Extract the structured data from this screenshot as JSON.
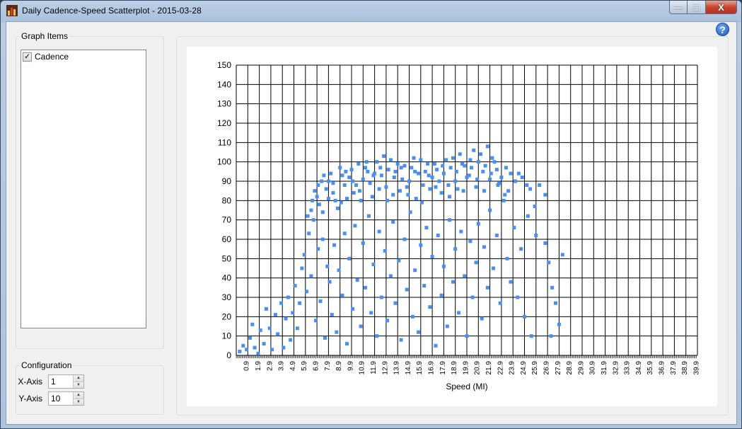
{
  "window": {
    "title": "Daily Cadence-Speed Scatterplot - 2015-03-28"
  },
  "caption_buttons": {
    "minimize": "—",
    "maximize": "□",
    "close": "X"
  },
  "help": {
    "label": "?"
  },
  "graph_items": {
    "legend": "Graph Items",
    "items": [
      {
        "label": "Cadence",
        "checked": true
      }
    ]
  },
  "configuration": {
    "legend": "Configuration",
    "x_axis": {
      "label": "X-Axis",
      "value": "1"
    },
    "y_axis": {
      "label": "Y-Axis",
      "value": "10"
    }
  },
  "colors": {
    "point": "#4a8ff0",
    "grid": "#000000"
  },
  "chart_data": {
    "type": "scatter",
    "xlabel": "Speed (MI)",
    "ylabel": "",
    "xlim": [
      0,
      40
    ],
    "ylim": [
      0,
      150
    ],
    "x_ticks": [
      "0.9",
      "1.9",
      "2.9",
      "3.9",
      "4.9",
      "5.9",
      "6.9",
      "7.9",
      "8.9",
      "9.9",
      "10.9",
      "11.9",
      "12.9",
      "13.9",
      "14.9",
      "15.9",
      "16.9",
      "17.9",
      "18.9",
      "19.9",
      "20.9",
      "21.9",
      "22.9",
      "23.9",
      "24.9",
      "25.9",
      "26.9",
      "27.9",
      "28.9",
      "29.9",
      "30.9",
      "31.9",
      "32.9",
      "33.9",
      "34.9",
      "35.9",
      "36.9",
      "37.9",
      "38.9",
      "39.9"
    ],
    "y_ticks": [
      "0",
      "10",
      "20",
      "30",
      "40",
      "50",
      "60",
      "70",
      "80",
      "90",
      "100",
      "110",
      "120",
      "130",
      "140",
      "150"
    ],
    "series": [
      {
        "color": "#4a8ff0",
        "points": [
          [
            0.3,
            2
          ],
          [
            0.6,
            5
          ],
          [
            0.9,
            3
          ],
          [
            1.2,
            9
          ],
          [
            1.4,
            16
          ],
          [
            1.6,
            4
          ],
          [
            1.9,
            1
          ],
          [
            2.1,
            13
          ],
          [
            2.4,
            6
          ],
          [
            2.6,
            24
          ],
          [
            2.9,
            14
          ],
          [
            3.1,
            3
          ],
          [
            3.4,
            21
          ],
          [
            3.6,
            11
          ],
          [
            3.9,
            27
          ],
          [
            4.1,
            4
          ],
          [
            4.3,
            19
          ],
          [
            4.5,
            30
          ],
          [
            4.7,
            8
          ],
          [
            4.9,
            22
          ],
          [
            5.1,
            36
          ],
          [
            5.3,
            14
          ],
          [
            5.5,
            27
          ],
          [
            5.7,
            45
          ],
          [
            5.9,
            52
          ],
          [
            6.1,
            33
          ],
          [
            6.3,
            63
          ],
          [
            6.5,
            41
          ],
          [
            6.7,
            70
          ],
          [
            6.9,
            18
          ],
          [
            7.1,
            55
          ],
          [
            7.3,
            28
          ],
          [
            7.5,
            60
          ],
          [
            7.7,
            9
          ],
          [
            7.9,
            46
          ],
          [
            8.1,
            38
          ],
          [
            8.3,
            21
          ],
          [
            8.5,
            57
          ],
          [
            8.7,
            12
          ],
          [
            8.9,
            44
          ],
          [
            9.2,
            31
          ],
          [
            9.4,
            63
          ],
          [
            9.6,
            6
          ],
          [
            9.8,
            50
          ],
          [
            10.1,
            24
          ],
          [
            10.3,
            67
          ],
          [
            10.5,
            39
          ],
          [
            10.8,
            15
          ],
          [
            11.0,
            58
          ],
          [
            11.2,
            35
          ],
          [
            11.5,
            72
          ],
          [
            11.7,
            22
          ],
          [
            11.9,
            47
          ],
          [
            12.2,
            10
          ],
          [
            12.4,
            64
          ],
          [
            12.6,
            30
          ],
          [
            12.9,
            54
          ],
          [
            13.1,
            18
          ],
          [
            13.4,
            41
          ],
          [
            13.6,
            69
          ],
          [
            13.8,
            27
          ],
          [
            14.1,
            49
          ],
          [
            14.3,
            8
          ],
          [
            14.6,
            60
          ],
          [
            14.8,
            34
          ],
          [
            15.1,
            74
          ],
          [
            15.3,
            20
          ],
          [
            15.5,
            44
          ],
          [
            15.8,
            12
          ],
          [
            16.0,
            57
          ],
          [
            16.3,
            36
          ],
          [
            16.5,
            66
          ],
          [
            16.8,
            25
          ],
          [
            17.0,
            51
          ],
          [
            17.3,
            5
          ],
          [
            17.5,
            62
          ],
          [
            17.8,
            31
          ],
          [
            18.0,
            46
          ],
          [
            18.3,
            15
          ],
          [
            18.5,
            70
          ],
          [
            18.8,
            38
          ],
          [
            19.0,
            55
          ],
          [
            19.3,
            22
          ],
          [
            19.5,
            64
          ],
          [
            19.8,
            41
          ],
          [
            20.0,
            10
          ],
          [
            20.3,
            59
          ],
          [
            20.5,
            30
          ],
          [
            20.8,
            48
          ],
          [
            21.0,
            68
          ],
          [
            21.3,
            19
          ],
          [
            21.5,
            56
          ],
          [
            21.8,
            35
          ],
          [
            22.0,
            75
          ],
          [
            22.3,
            45
          ],
          [
            22.6,
            62
          ],
          [
            22.9,
            27
          ],
          [
            23.2,
            80
          ],
          [
            23.5,
            50
          ],
          [
            23.8,
            38
          ],
          [
            24.1,
            66
          ],
          [
            24.4,
            30
          ],
          [
            24.7,
            55
          ],
          [
            25.0,
            20
          ],
          [
            25.3,
            72
          ],
          [
            25.6,
            10
          ],
          [
            26.0,
            62
          ],
          [
            26.8,
            58
          ],
          [
            27.1,
            48
          ],
          [
            27.4,
            35
          ],
          [
            27.7,
            27
          ],
          [
            28.0,
            16
          ],
          [
            27.3,
            10
          ],
          [
            28.3,
            52
          ],
          [
            26.3,
            88
          ],
          [
            26.8,
            83
          ],
          [
            25.5,
            86
          ],
          [
            24.8,
            92
          ],
          [
            24.5,
            94
          ],
          [
            25.2,
            88
          ],
          [
            25.9,
            77
          ],
          [
            6.5,
            75
          ],
          [
            7.0,
            82
          ],
          [
            7.4,
            90
          ],
          [
            7.8,
            86
          ],
          [
            8.2,
            94
          ],
          [
            8.6,
            80
          ],
          [
            9.0,
            97
          ],
          [
            9.4,
            88
          ],
          [
            9.8,
            92
          ],
          [
            10.2,
            84
          ],
          [
            10.6,
            99
          ],
          [
            11.0,
            91
          ],
          [
            11.4,
            95
          ],
          [
            11.8,
            82
          ],
          [
            12.2,
            100
          ],
          [
            12.6,
            93
          ],
          [
            13.0,
            87
          ],
          [
            13.4,
            101
          ],
          [
            13.8,
            95
          ],
          [
            14.2,
            85
          ],
          [
            14.6,
            98
          ],
          [
            15.0,
            90
          ],
          [
            15.4,
            102
          ],
          [
            15.8,
            94
          ],
          [
            16.2,
            88
          ],
          [
            16.6,
            99
          ],
          [
            17.0,
            92
          ],
          [
            17.4,
            96
          ],
          [
            17.8,
            84
          ],
          [
            18.2,
            101
          ],
          [
            18.6,
            97
          ],
          [
            19.0,
            90
          ],
          [
            19.4,
            104
          ],
          [
            19.8,
            98
          ],
          [
            20.2,
            93
          ],
          [
            20.6,
            106
          ],
          [
            21.0,
            100
          ],
          [
            21.4,
            95
          ],
          [
            21.8,
            108
          ],
          [
            22.2,
            102
          ],
          [
            22.6,
            96
          ],
          [
            23.0,
            92
          ],
          [
            23.4,
            97
          ],
          [
            23.8,
            94
          ],
          [
            24.2,
            90
          ],
          [
            6.8,
            85
          ],
          [
            7.2,
            78
          ],
          [
            7.6,
            93
          ],
          [
            8.0,
            81
          ],
          [
            8.4,
            89
          ],
          [
            8.8,
            76
          ],
          [
            9.2,
            93
          ],
          [
            9.6,
            81
          ],
          [
            10.0,
            96
          ],
          [
            10.4,
            88
          ],
          [
            10.8,
            80
          ],
          [
            11.2,
            97
          ],
          [
            11.6,
            89
          ],
          [
            12.0,
            94
          ],
          [
            12.4,
            86
          ],
          [
            12.8,
            103
          ],
          [
            13.2,
            96
          ],
          [
            13.6,
            83
          ],
          [
            14.0,
            99
          ],
          [
            14.4,
            91
          ],
          [
            14.8,
            87
          ],
          [
            15.2,
            97
          ],
          [
            15.6,
            81
          ],
          [
            16.0,
            101
          ],
          [
            16.4,
            95
          ],
          [
            16.8,
            86
          ],
          [
            17.2,
            99
          ],
          [
            17.6,
            90
          ],
          [
            18.0,
            94
          ],
          [
            18.4,
            88
          ],
          [
            18.8,
            102
          ],
          [
            19.2,
            86
          ],
          [
            19.6,
            99
          ],
          [
            20.0,
            92
          ],
          [
            20.4,
            97
          ],
          [
            20.8,
            87
          ],
          [
            21.2,
            104
          ],
          [
            21.6,
            98
          ],
          [
            22.0,
            91
          ],
          [
            22.4,
            100
          ],
          [
            22.8,
            89
          ],
          [
            23.6,
            85
          ],
          [
            6.2,
            72
          ],
          [
            6.6,
            80
          ],
          [
            7.1,
            88
          ],
          [
            7.5,
            74
          ],
          [
            8.0,
            90
          ],
          [
            8.4,
            84
          ],
          [
            9.1,
            79
          ],
          [
            9.5,
            95
          ],
          [
            10.1,
            90
          ],
          [
            10.7,
            85
          ],
          [
            11.3,
            100
          ],
          [
            11.9,
            93
          ],
          [
            12.5,
            97
          ],
          [
            13.1,
            80
          ],
          [
            13.7,
            92
          ],
          [
            14.3,
            97
          ],
          [
            14.9,
            83
          ],
          [
            15.5,
            95
          ],
          [
            16.1,
            79
          ],
          [
            16.7,
            93
          ],
          [
            17.3,
            87
          ],
          [
            17.9,
            98
          ],
          [
            18.5,
            82
          ],
          [
            19.1,
            95
          ],
          [
            19.7,
            85
          ],
          [
            20.3,
            101
          ],
          [
            20.9,
            91
          ],
          [
            21.5,
            85
          ],
          [
            22.1,
            94
          ],
          [
            22.7,
            88
          ],
          [
            23.3,
            83
          ]
        ]
      }
    ]
  }
}
